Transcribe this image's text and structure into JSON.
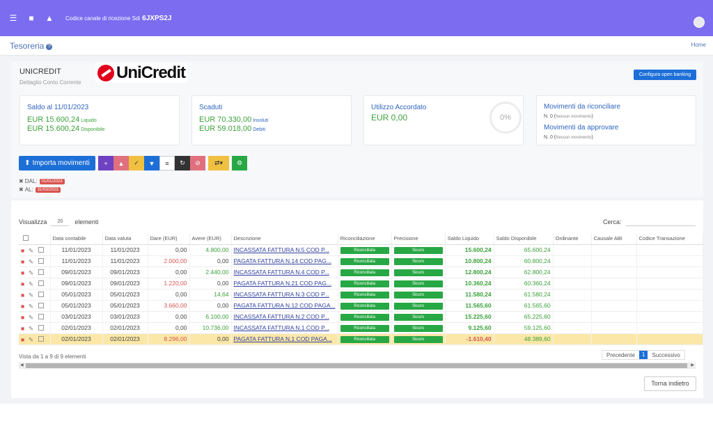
{
  "topbar": {
    "sdi_label": "Codice canale di ricezione Sdi",
    "sdi_code": "6JXPS2J",
    "brand_color": "#7b6cf0"
  },
  "page": {
    "title": "Tesoreria",
    "home_link": "Home"
  },
  "bank": {
    "name": "UNICREDIT",
    "subtitle": "Dettaglio Conto Corrente",
    "logo_text": "UniCredit",
    "open_banking_btn": "Configura open banking"
  },
  "cards": {
    "saldo": {
      "title": "Saldo al 11/01/2023",
      "line1": "EUR 15.600,24",
      "line1_sub": "Liquido",
      "line2": "EUR 15.600,24",
      "line2_sub": "Disponibile"
    },
    "scaduti": {
      "title": "Scaduti",
      "line1": "EUR 70.330,00",
      "line1_sub": "Insoluti",
      "line2": "EUR 59.018,00",
      "line2_sub": "Debiti"
    },
    "accordato": {
      "title": "Utilizzo Accordato",
      "value": "EUR 0,00",
      "gauge": "0%"
    },
    "movimenti": {
      "title1": "Movimenti da riconciliare",
      "line1": "N. 0 (",
      "line1_sub": "Nessun movimento",
      "line1_end": ")",
      "title2": "Movimenti da approvare",
      "line2": "N. 0 (",
      "line2_sub": "Nessun movimento",
      "line2_end": ")"
    }
  },
  "toolbar": {
    "import_label": "Importa movimenti"
  },
  "filters": {
    "dal_label": "DAL:",
    "dal_value": "01/01/2023",
    "al_label": "AL:",
    "al_value": "31/03/2023"
  },
  "table_controls": {
    "show_label": "Visualizza",
    "show_value": "20",
    "show_suffix": "elementi",
    "search_label": "Cerca:"
  },
  "table": {
    "headers": [
      "",
      "Data contabile",
      "Data valuta",
      "Dare (EUR)",
      "Avere (EUR)",
      "Descrizione",
      "Riconciliazione",
      "Precisione",
      "Saldo Liquido",
      "Saldo Disponibile",
      "Ordinante",
      "Causale ABI",
      "Codice Transazione"
    ],
    "rows": [
      {
        "dc": "11/01/2023",
        "dv": "11/01/2023",
        "dare": "0,00",
        "avere": "4.800,00",
        "desc": "INCASSATA FATTURA N.5 COD P...",
        "ric": "Riconciliata",
        "prec": "Sicuro",
        "liq": "15.600,24",
        "disp": "65.600,24"
      },
      {
        "dc": "11/01/2023",
        "dv": "11/01/2023",
        "dare": "2.000,00",
        "avere": "0,00",
        "desc": "PAGATA FATTURA N.14 COD PAG...",
        "ric": "Riconciliata",
        "prec": "Sicuro",
        "liq": "10.800,24",
        "disp": "60.800,24"
      },
      {
        "dc": "09/01/2023",
        "dv": "09/01/2023",
        "dare": "0,00",
        "avere": "2.440,00",
        "desc": "INCASSATA FATTURA N.4 COD P...",
        "ric": "Riconciliata",
        "prec": "Sicuro",
        "liq": "12.800,24",
        "disp": "62.800,24"
      },
      {
        "dc": "09/01/2023",
        "dv": "09/01/2023",
        "dare": "1.220,00",
        "avere": "0,00",
        "desc": "PAGATA FATTURA N.21 COD PAG...",
        "ric": "Riconciliata",
        "prec": "Sicuro",
        "liq": "10.360,24",
        "disp": "60.360,24"
      },
      {
        "dc": "05/01/2023",
        "dv": "05/01/2023",
        "dare": "0,00",
        "avere": "14,64",
        "desc": "INCASSATA FATTURA N.3 COD P...",
        "ric": "Riconciliata",
        "prec": "Sicuro",
        "liq": "11.580,24",
        "disp": "61.580,24"
      },
      {
        "dc": "05/01/2023",
        "dv": "05/01/2023",
        "dare": "3.660,00",
        "avere": "0,00",
        "desc": "PAGATA FATTURA N.12 COD PAGA...",
        "ric": "Riconciliata",
        "prec": "Sicuro",
        "liq": "11.565,60",
        "disp": "61.565,60"
      },
      {
        "dc": "03/01/2023",
        "dv": "03/01/2023",
        "dare": "0,00",
        "avere": "6.100,00",
        "desc": "INCASSATA FATTURA N.2 COD P...",
        "ric": "Riconciliata",
        "prec": "Sicuro",
        "liq": "15.225,60",
        "disp": "65.225,60"
      },
      {
        "dc": "02/01/2023",
        "dv": "02/01/2023",
        "dare": "0,00",
        "avere": "10.736,00",
        "desc": "INCASSATA FATTURA N.1 COD P...",
        "ric": "Riconciliata",
        "prec": "Sicuro",
        "liq": "9.125,60",
        "disp": "59.125,60"
      },
      {
        "dc": "02/01/2023",
        "dv": "02/01/2023",
        "dare": "8.296,00",
        "avere": "0,00",
        "desc": "PAGATA FATTURA N.1 COD PAGA...",
        "ric": "Riconciliata",
        "prec": "Sicuro",
        "liq": "-1.610,40",
        "disp": "48.389,60"
      }
    ]
  },
  "footer": {
    "info": "Vista da 1 a 9 di 9 elementi",
    "prev": "Precedente",
    "page": "1",
    "next": "Successivo",
    "back_btn": "Torna indietro"
  }
}
